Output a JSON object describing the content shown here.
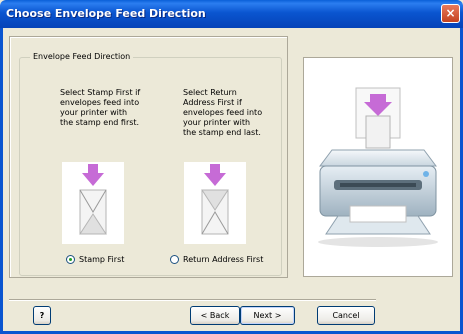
{
  "window": {
    "title": "Choose Envelope Feed Direction",
    "close_glyph": "×"
  },
  "group": {
    "title": "Envelope Feed Direction"
  },
  "options": {
    "left": {
      "description": "Select Stamp First if\nenvelopes feed into\nyour printer with\nthe stamp end first.",
      "label": "Stamp First",
      "selected": true
    },
    "right": {
      "description": "Select Return\nAddress First if\nenvelopes feed into\nyour printer with\nthe stamp end last.",
      "label": "Return Address First",
      "selected": false
    }
  },
  "buttons": {
    "help": "?",
    "back": "< Back",
    "next": "Next >",
    "cancel": "Cancel"
  },
  "colors": {
    "arrow": "#c66bd6",
    "titlebar": "#0a55d0"
  },
  "icons": [
    "close-icon",
    "down-arrow-icon",
    "envelope-icon",
    "printer-icon",
    "help-icon"
  ]
}
